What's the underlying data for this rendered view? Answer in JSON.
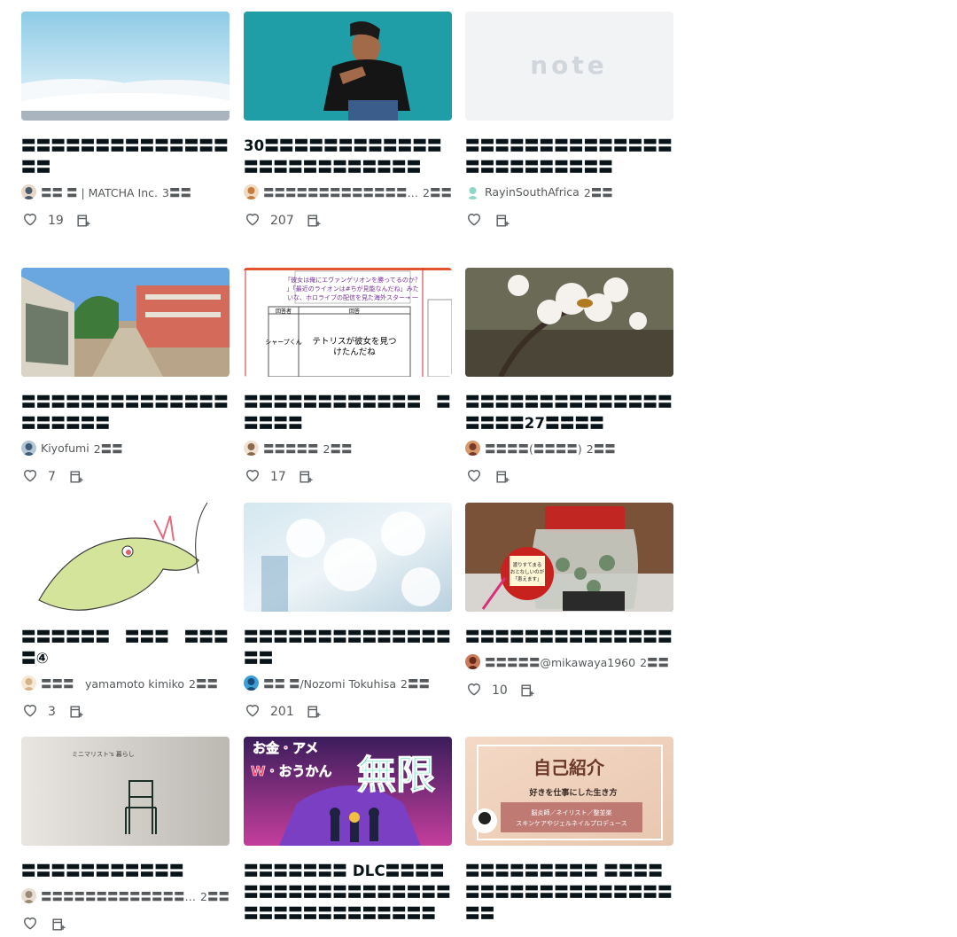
{
  "articles": [
    {
      "title": "〓〓〓〓〓〓〓〓〓〓〓〓〓〓〓〓",
      "author": "〓〓 〓 | MATCHA Inc.",
      "age": "3〓〓",
      "likes": "19",
      "thumb": "sky",
      "avatar": "a1"
    },
    {
      "title": "30〓〓〓〓〓〓〓〓〓〓〓〓〓〓〓〓〓〓〓〓〓〓〓〓",
      "author": "〓〓〓〓〓〓〓〓〓〓〓〓〓〓〓〓〓〓〓〓〓〓〓〓T...",
      "age": "2〓〓",
      "likes": "207",
      "thumb": "man",
      "avatar": "a2"
    },
    {
      "title": "〓〓〓〓〓〓〓〓〓〓〓〓〓〓〓〓〓〓〓〓〓〓〓〓",
      "author": "RayinSouthAfrica",
      "age": "2〓〓",
      "likes": "",
      "thumb": "note",
      "avatar": "a3"
    },
    {
      "title": "〓〓〓〓〓〓〓〓〓〓〓〓〓〓〓〓〓〓〓〓",
      "author": "Kiyofumi",
      "age": "2〓〓",
      "likes": "7",
      "thumb": "street",
      "avatar": "a4"
    },
    {
      "title": "〓〓〓〓〓〓〓〓〓〓〓〓　〓〓〓〓〓",
      "author": "〓〓〓〓〓",
      "age": "2〓〓",
      "likes": "17",
      "thumb": "table",
      "avatar": "a5"
    },
    {
      "title": "〓〓〓〓〓〓〓〓〓〓〓〓〓〓〓〓〓〓27〓〓〓〓",
      "author": "〓〓〓〓(〓〓〓〓)",
      "age": "2〓〓",
      "likes": "",
      "thumb": "blossom",
      "avatar": "a6"
    },
    {
      "title": "〓〓〓〓〓〓　〓〓〓　〓〓〓〓④",
      "author": "〓〓〓　yamamoto kimiko",
      "age": "2〓〓",
      "likes": "3",
      "thumb": "dragon",
      "avatar": "a7"
    },
    {
      "title": "〓〓〓〓〓〓〓〓〓〓〓〓〓〓〓〓",
      "author": "〓〓 〓/Nozomi Tokuhisa",
      "age": "2〓〓",
      "likes": "201",
      "thumb": "frost",
      "avatar": "a8"
    },
    {
      "title": "〓〓〓〓〓〓〓〓〓〓〓〓〓〓",
      "author": "〓〓〓〓〓@mikawaya1960",
      "age": "2〓〓",
      "likes": "10",
      "thumb": "jar",
      "avatar": "a9"
    },
    {
      "title": "〓〓〓〓〓〓〓〓〓〓〓",
      "author": "〓〓〓〓〓〓〓〓〓〓〓〓〓〓〓〓",
      "age": "2〓〓",
      "likes": "",
      "thumb": "chair",
      "avatar": "a10"
    },
    {
      "title": "〓〓〓〓〓〓〓 DLC〓〓〓〓〓〓〓〓〓〓〓〓〓〓〓〓〓〓〓〓〓〓〓〓〓〓〓〓〓〓〓",
      "author": "",
      "age": "",
      "likes": "",
      "thumb": "game",
      "avatar": ""
    },
    {
      "title": "〓〓〓〓〓〓〓〓〓 〓〓〓〓〓〓〓〓〓〓〓〓〓〓〓〓〓〓〓〓",
      "author": "",
      "age": "",
      "likes": "",
      "thumb": "intro",
      "avatar": ""
    }
  ],
  "thumb_text": {
    "note_logo": "note",
    "chair_caption": "ミニマリスト's 暮らし",
    "table_top": "「彼女は俺にエヴァンゲリオンを勝ってるのか？」「最近のライオンは#ちが見能なんだね」みたいな、ホロライブの配信を見た海外スター→ 一蓮",
    "table_label_left": "シャープくん",
    "table_label_mid": "テトリスが彼女を見つけたんだね",
    "table_head_a": "回答者",
    "table_head_b": "回答",
    "jar_note": "渡りすてまる\nおとなしいのが\nいいから\n「恵えます」",
    "game_line1": "お金・アメ",
    "game_line2": "W・おうかん",
    "game_big": "無限",
    "intro_title": "自己紹介",
    "intro_sub": "好きを仕事にした生き方",
    "intro_tags": "脳炎師／ネイリスト／整並楽",
    "intro_tags2": "スキンケアやジェルネイルプロデュース"
  }
}
